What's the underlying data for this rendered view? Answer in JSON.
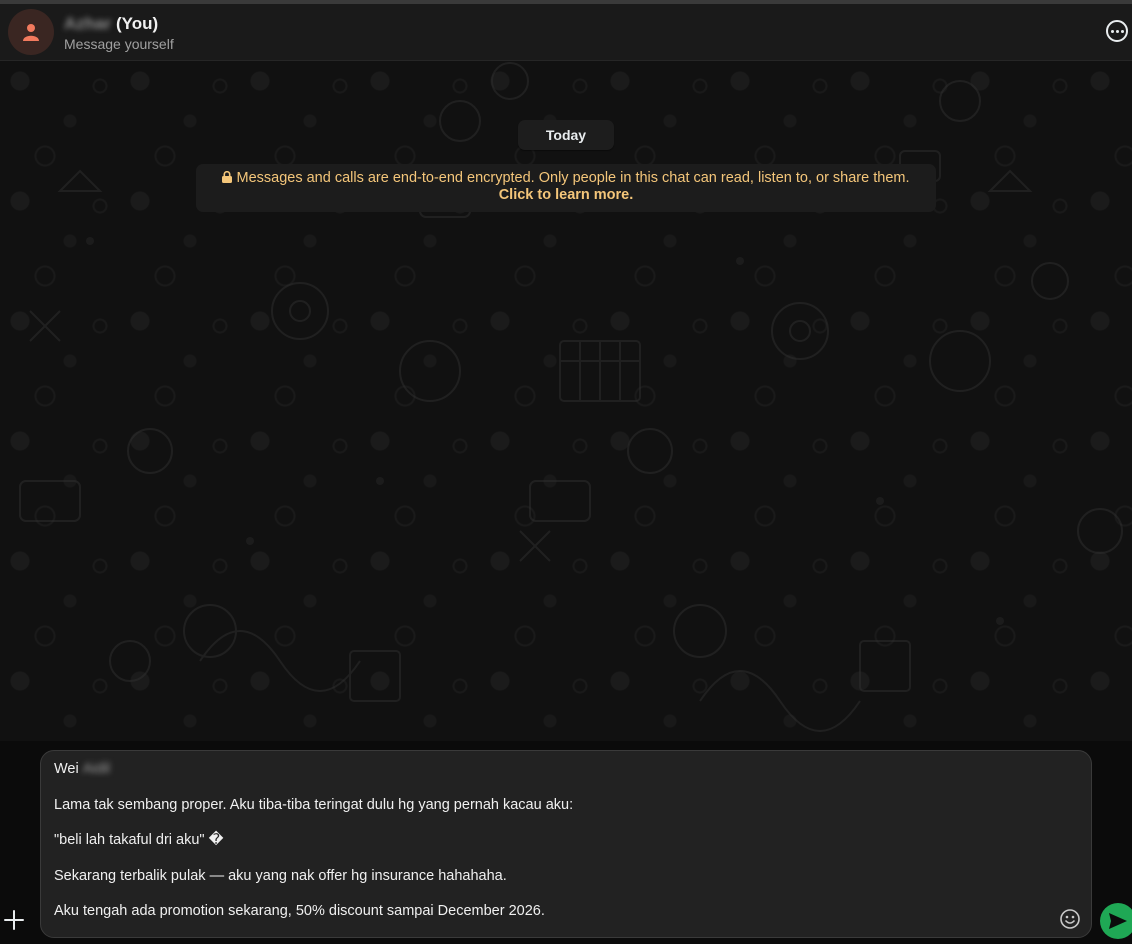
{
  "header": {
    "contact_name": "Azhar",
    "you_suffix": "(You)",
    "subtitle": "Message yourself",
    "menu_icon": "more-options-icon",
    "avatar_icon": "person-icon"
  },
  "chat": {
    "date_label": "Today",
    "encryption_notice": "Messages and calls are end-to-end encrypted. Only people in this chat can read, listen to, or share them.",
    "encryption_link": "Click to learn more."
  },
  "composer": {
    "lines": {
      "l1_text": "Wei",
      "l1_blurred": "Aidil",
      "l2": "Lama tak sembang proper. Aku tiba-tiba teringat dulu hg yang pernah kacau aku:",
      "l3": "\"beli lah takaful dri aku\" �",
      "l4": "Sekarang terbalik pulak — aku yang nak offer hg insurance hahahaha.",
      "l5": "Aku tengah ada promotion sekarang, 50% discount sampai December 2026."
    },
    "plus_icon": "plus-icon",
    "emoji_icon": "emoji-icon",
    "send_icon": "send-icon"
  },
  "colors": {
    "accent_send": "#1fa855",
    "encryption_text": "#f4c67a",
    "avatar_icon": "#f27a5e"
  }
}
